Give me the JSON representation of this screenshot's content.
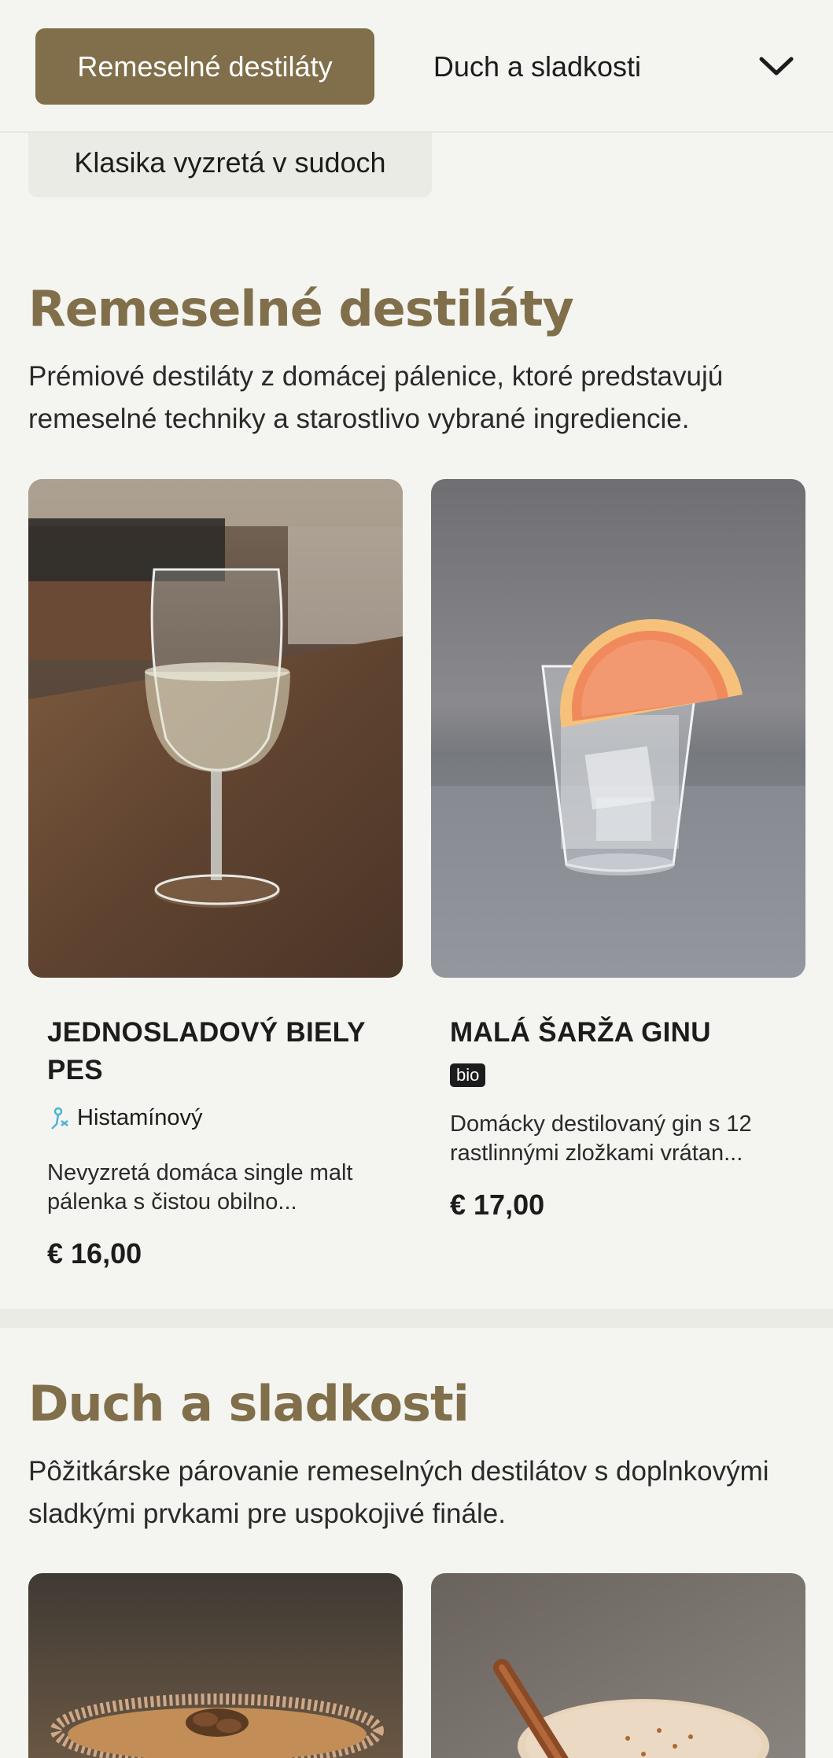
{
  "nav": {
    "active_label": "Remeselné destiláty",
    "second_label": "Duch a sladkosti",
    "dropdown_label": "Klasika vyzretá v sudoch"
  },
  "sections": [
    {
      "title": "Remeselné destiláty",
      "description": "Prémiové destiláty z domácej pálenice, ktoré predstavujú remeselné techniky a starostlivo vybrané ingrediencie.",
      "products": [
        {
          "name": "JEDNOSLADOVÝ BIELY PES",
          "allergen": "Histamínový",
          "description": "Nevyzretá domáca single malt pálenka s čistou obilno...",
          "price": "€ 16,00"
        },
        {
          "name": "MALÁ ŠARŽA GINU",
          "badge": "bio",
          "description": "Domácky destilovaný gin s 12 rastlinnými zložkami vrátan...",
          "price": "€ 17,00"
        }
      ]
    },
    {
      "title": "Duch a sladkosti",
      "description": "Pôžitkárske párovanie remeselných destilátov s doplnkovými sladkými prvkami pre uspokojivé finále."
    }
  ],
  "colors": {
    "accent": "#806f4a",
    "background": "#f4f4f0",
    "allergen_icon": "#4bb4d8"
  },
  "icons": {
    "dropdown": "chevron-down-icon",
    "allergen": "histamine-icon"
  }
}
